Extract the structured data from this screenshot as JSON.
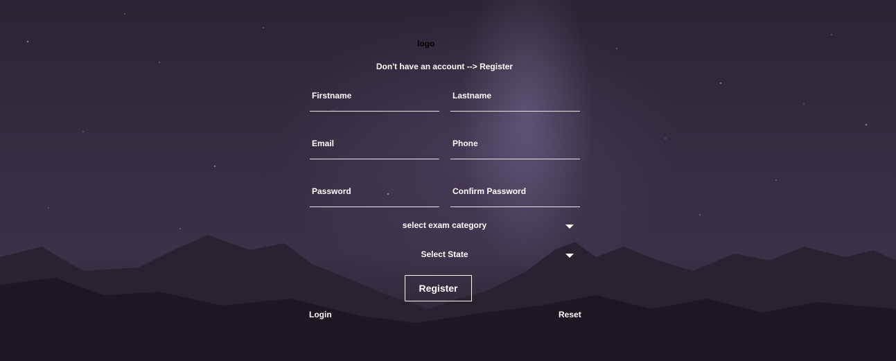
{
  "logo_alt": "logo",
  "subtitle": "Don't have an account --> Register",
  "fields": {
    "firstname": {
      "placeholder": "Firstname",
      "value": ""
    },
    "lastname": {
      "placeholder": "Lastname",
      "value": ""
    },
    "email": {
      "placeholder": "Email",
      "value": ""
    },
    "phone": {
      "placeholder": "Phone",
      "value": ""
    },
    "password": {
      "placeholder": "Password",
      "value": ""
    },
    "confirm_password": {
      "placeholder": "Confirm Password",
      "value": ""
    }
  },
  "selects": {
    "exam_category": "select exam category",
    "state": "Select State"
  },
  "buttons": {
    "register": "Register"
  },
  "links": {
    "login": "Login",
    "reset": "Reset"
  },
  "colors": {
    "text": "#ffffff",
    "sky": "#362d42",
    "mountains": "#231c29"
  },
  "icons": {
    "select_caret": "caret-down-icon"
  }
}
